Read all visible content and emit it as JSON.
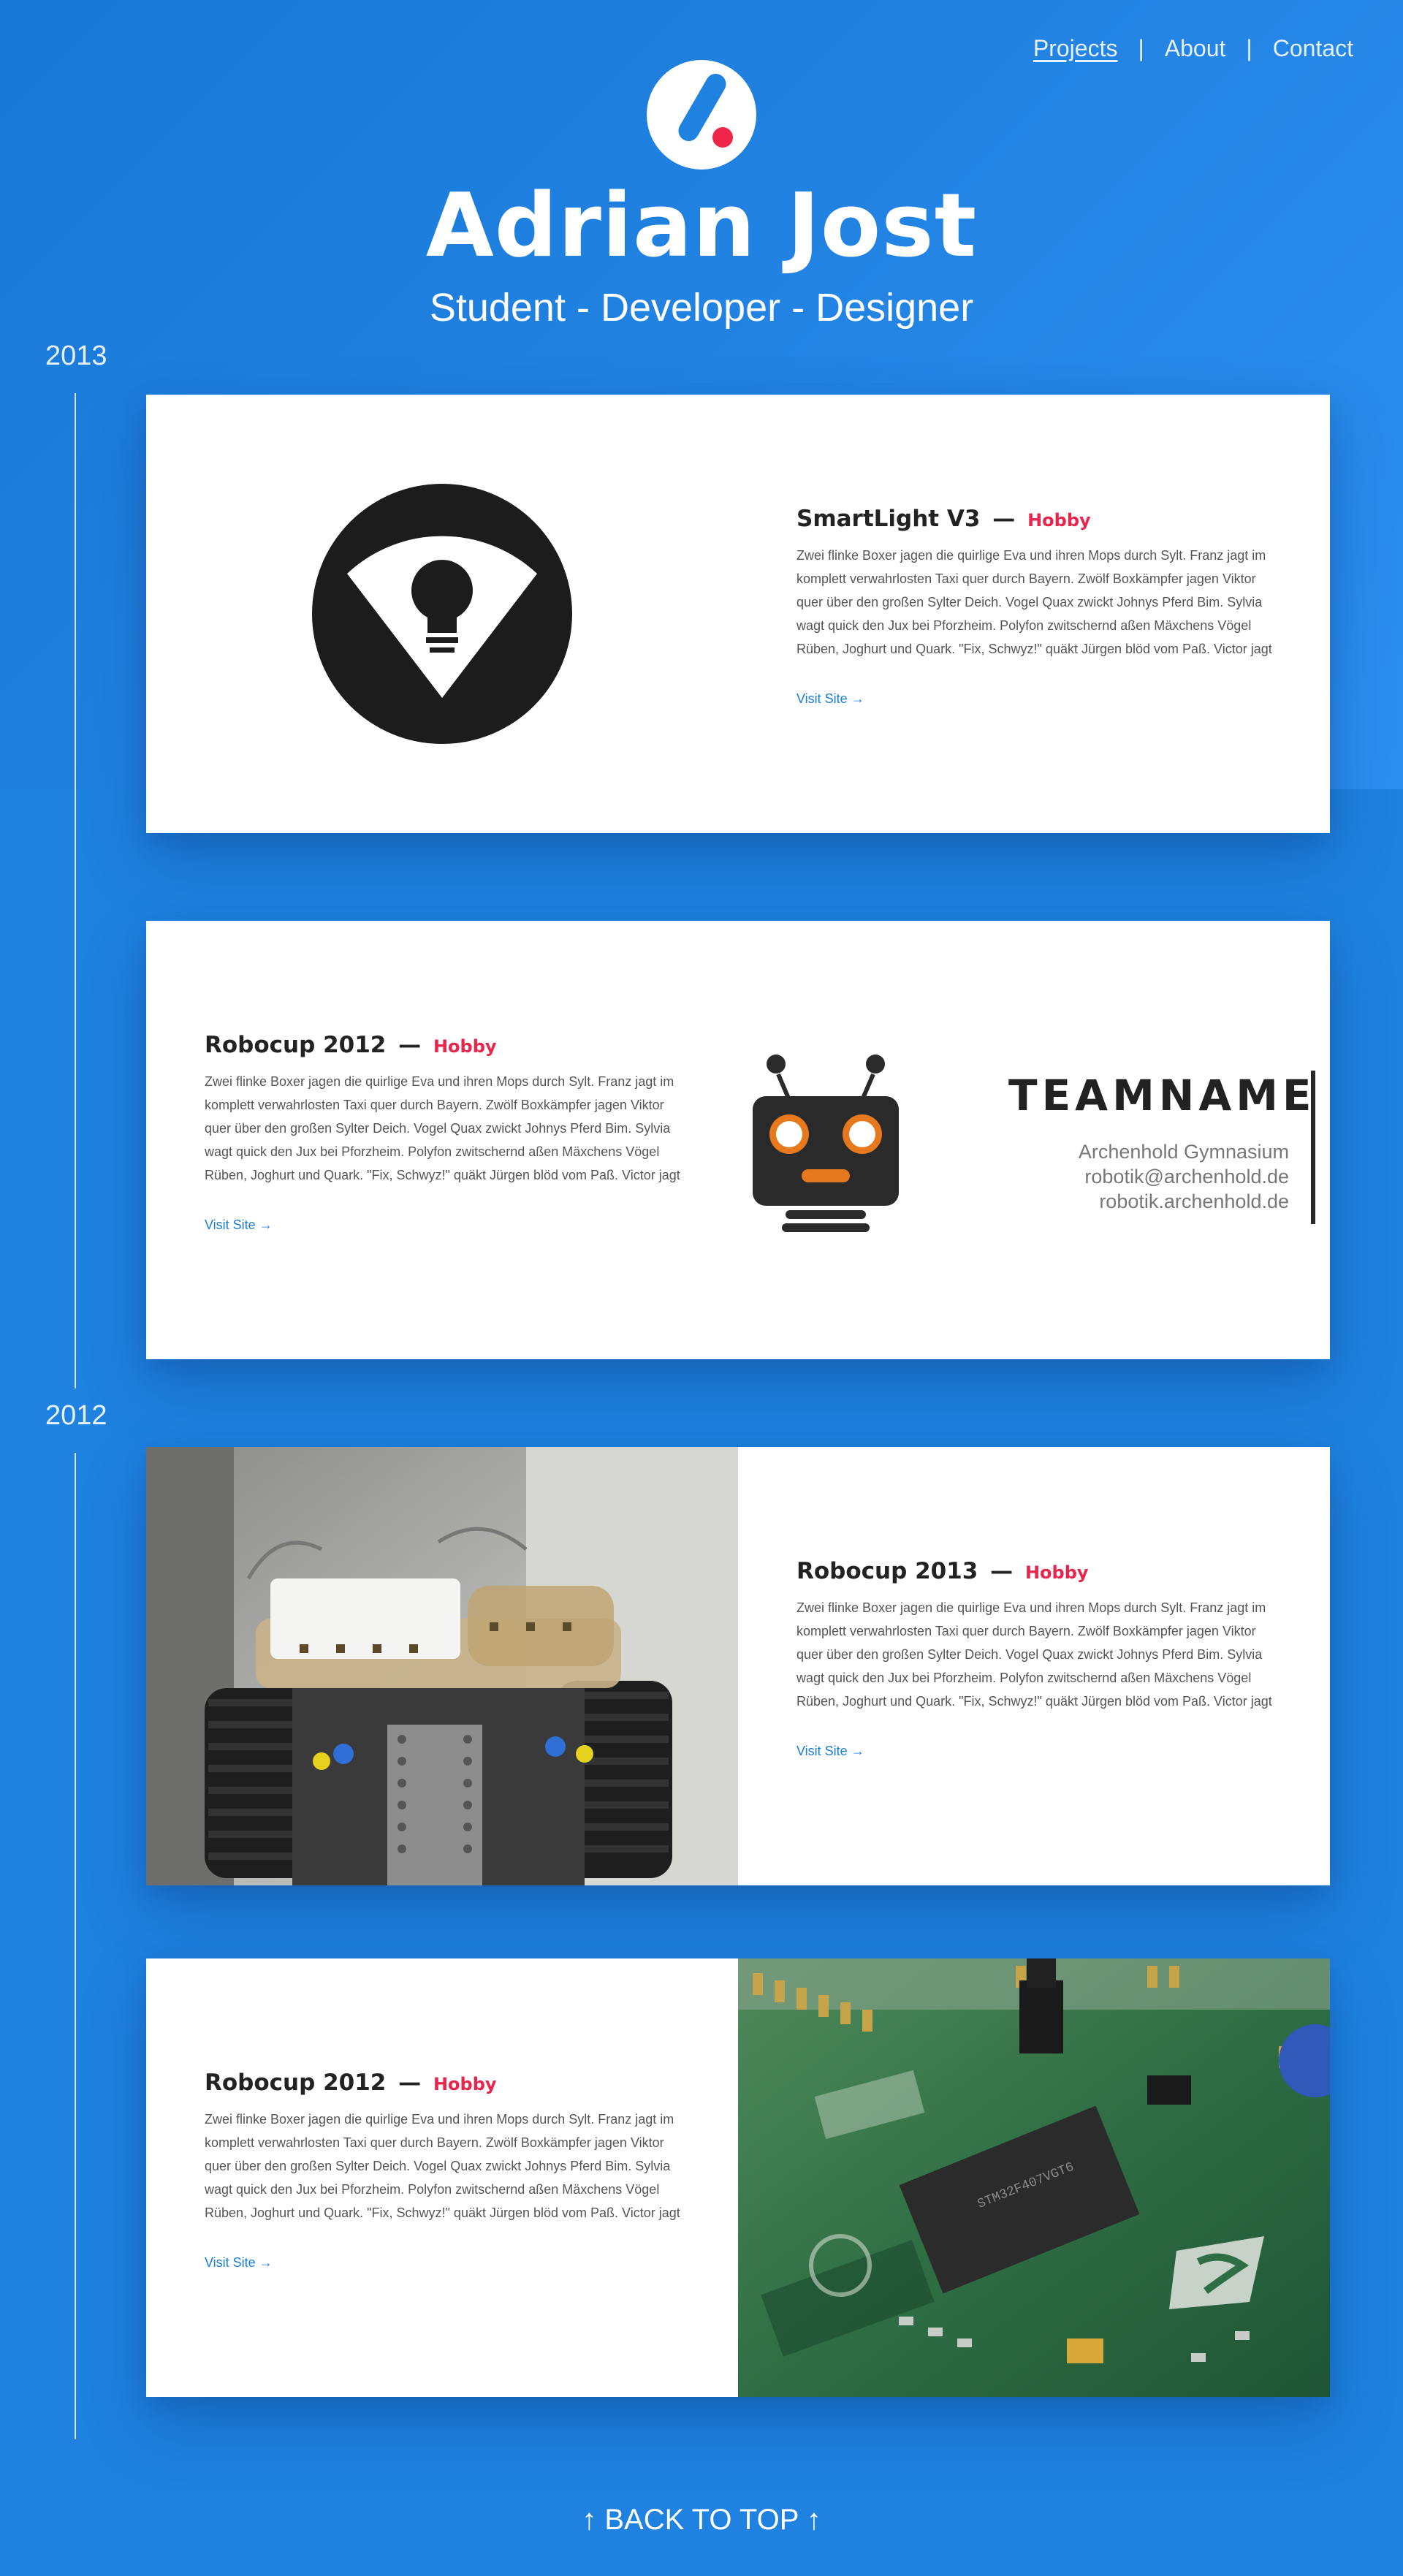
{
  "nav": {
    "items": [
      {
        "label": "Projects",
        "active": true
      },
      {
        "label": "About",
        "active": false
      },
      {
        "label": "Contact",
        "active": false
      }
    ],
    "separator": "|"
  },
  "header": {
    "name": "Adrian Jost",
    "subtitle": "Student - Developer - Designer"
  },
  "timeline": {
    "years": [
      "2013",
      "2012"
    ]
  },
  "projects": [
    {
      "title": "SmartLight V3",
      "dash": "—",
      "tag": "Hobby",
      "description": "Zwei flinke Boxer jagen die quirlige Eva und ihren Mops durch Sylt. Franz jagt im komplett verwahrlosten Taxi quer durch Bayern. Zwölf Boxkämpfer jagen Viktor quer über den großen Sylter Deich. Vogel Quax zwickt Johnys Pferd Bim. Sylvia wagt quick den Jux bei Pforzheim. Polyfon zwitschernd aßen Mäxchens Vögel Rüben, Joghurt und Quark. \"Fix, Schwyz!\" quäkt Jürgen blöd vom Paß. Victor jagt zwölf Boxkämpfer quer über den großen",
      "link": "Visit Site →"
    },
    {
      "title": "Robocup 2012",
      "dash": "—",
      "tag": "Hobby",
      "description": "Zwei flinke Boxer jagen die quirlige Eva und ihren Mops durch Sylt. Franz jagt im komplett verwahrlosten Taxi quer durch Bayern. Zwölf Boxkämpfer jagen Viktor quer über den großen Sylter Deich. Vogel Quax zwickt Johnys Pferd Bim. Sylvia wagt quick den Jux bei Pforzheim. Polyfon zwitschernd aßen Mäxchens Vögel Rüben, Joghurt und Quark. \"Fix, Schwyz!\" quäkt Jürgen blöd vom Paß. Victor jagt zwölf Boxkämpfer quer über den großen",
      "link": "Visit Site →",
      "team_logo": {
        "name": "TEAMNAME",
        "line1": "Archenhold Gymnasium",
        "line2": "robotik@archenhold.de",
        "line3": "robotik.archenhold.de"
      }
    },
    {
      "title": "Robocup 2013",
      "dash": "—",
      "tag": "Hobby",
      "description": "Zwei flinke Boxer jagen die quirlige Eva und ihren Mops durch Sylt. Franz jagt im komplett verwahrlosten Taxi quer durch Bayern. Zwölf Boxkämpfer jagen Viktor quer über den großen Sylter Deich. Vogel Quax zwickt Johnys Pferd Bim. Sylvia wagt quick den Jux bei Pforzheim. Polyfon zwitschernd aßen Mäxchens Vögel Rüben, Joghurt und Quark. \"Fix, Schwyz!\" quäkt Jürgen blöd vom Paß. Victor jagt zwölf Boxkämpfer quer über den großen",
      "link": "Visit Site →"
    },
    {
      "title": "Robocup 2012",
      "dash": "—",
      "tag": "Hobby",
      "description": "Zwei flinke Boxer jagen die quirlige Eva und ihren Mops durch Sylt. Franz jagt im komplett verwahrlosten Taxi quer durch Bayern. Zwölf Boxkämpfer jagen Viktor quer über den großen Sylter Deich. Vogel Quax zwickt Johnys Pferd Bim. Sylvia wagt quick den Jux bei Pforzheim. Polyfon zwitschernd aßen Mäxchens Vögel Rüben, Joghurt und Quark. \"Fix, Schwyz!\" quäkt Jürgen blöd vom Paß. Victor jagt zwölf Boxkämpfer quer über den großen",
      "link": "Visit Site →",
      "chip_label": "STM32F407VGT6"
    }
  ],
  "footer": {
    "back_to_top": "↑ BACK TO TOP ↑"
  },
  "colors": {
    "primary_blue": "#1f82e0",
    "accent_red": "#e8254c",
    "link_blue": "#1a7fd6"
  }
}
